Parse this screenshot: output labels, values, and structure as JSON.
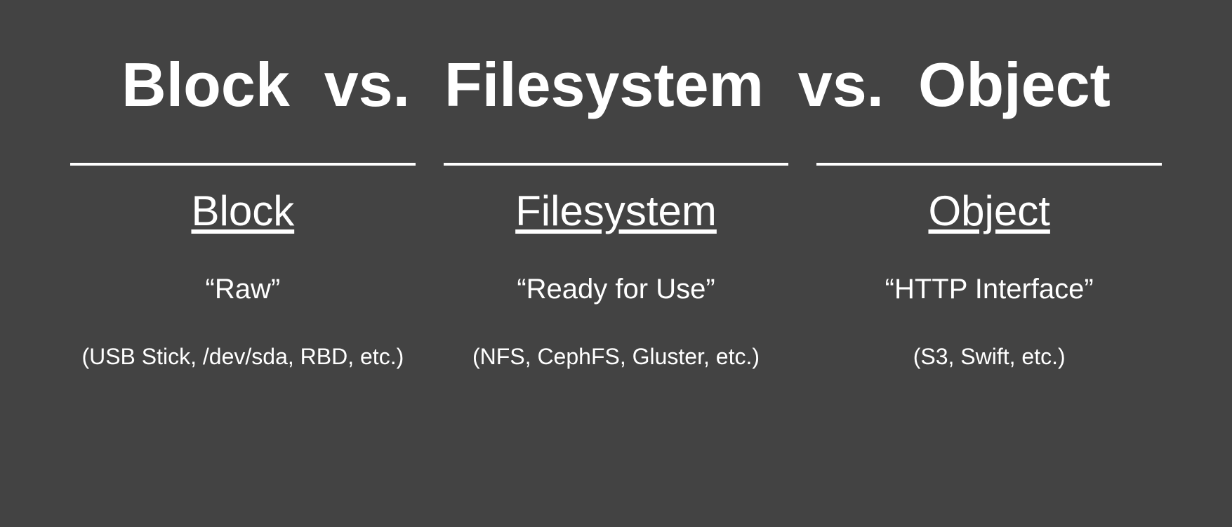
{
  "title": "Block  vs.  Filesystem  vs.  Object",
  "columns": [
    {
      "heading": "Block",
      "tagline": "“Raw”",
      "examples": "(USB Stick, /dev/sda, RBD, etc.)"
    },
    {
      "heading": "Filesystem",
      "tagline": "“Ready for Use”",
      "examples": "(NFS, CephFS, Gluster, etc.)"
    },
    {
      "heading": "Object",
      "tagline": "“HTTP Interface”",
      "examples": "(S3, Swift, etc.)"
    }
  ]
}
